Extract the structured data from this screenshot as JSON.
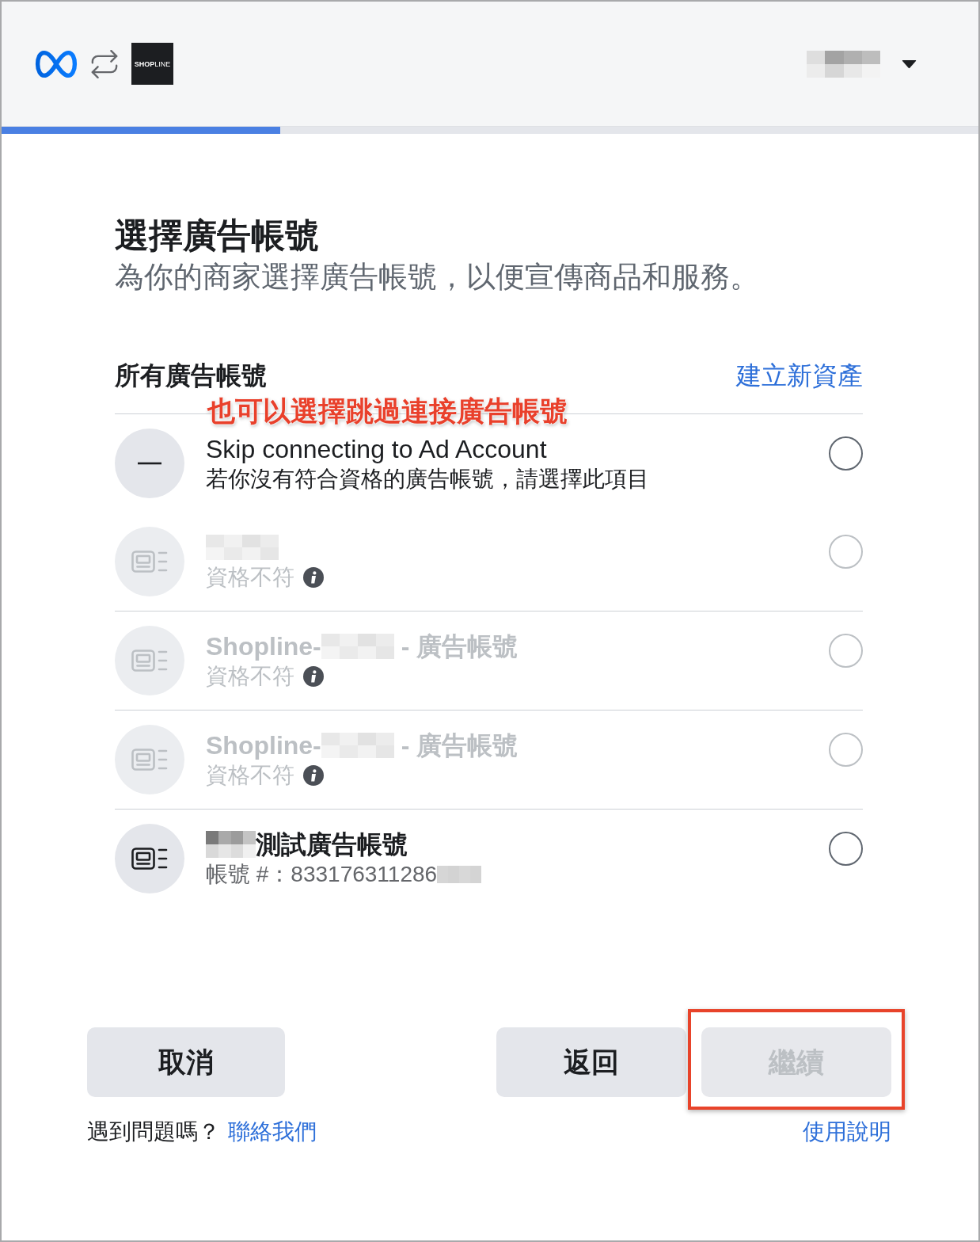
{
  "header": {
    "logo_text": "**SHOP**LINE"
  },
  "progress": {
    "level": 0.285
  },
  "title": "選擇廣告帳號",
  "subtitle": "為你的商家選擇廣告帳號，以便宣傳商品和服務。",
  "list": {
    "heading": "所有廣告帳號",
    "create_link": "建立新資產",
    "annotation": "也可以選擇跳過連接廣告帳號",
    "rows": [
      {
        "kind": "skip",
        "title": [
          {
            "kind": "text",
            "text": "Skip connecting to Ad Account"
          }
        ],
        "subtitle": [
          {
            "kind": "text",
            "text": "若你沒有符合資格的廣告帳號，請選擇此項目"
          }
        ],
        "disabled": false,
        "selected": false
      },
      {
        "kind": "account",
        "title": [
          {
            "kind": "redacted"
          }
        ],
        "subtitle": [
          {
            "kind": "text",
            "text": "資格不符"
          }
        ],
        "disabled": true,
        "selected": false
      },
      {
        "kind": "account",
        "title": [
          {
            "kind": "text",
            "text": "Shopline-"
          },
          {
            "kind": "redacted"
          },
          {
            "kind": "text",
            "text": " - 廣告帳號"
          }
        ],
        "subtitle": [
          {
            "kind": "text",
            "text": "資格不符"
          }
        ],
        "disabled": true,
        "selected": false
      },
      {
        "kind": "account",
        "title": [
          {
            "kind": "text",
            "text": "Shopline-"
          },
          {
            "kind": "redacted"
          },
          {
            "kind": "text",
            "text": " - 廣告帳號"
          }
        ],
        "subtitle": [
          {
            "kind": "text",
            "text": "資格不符"
          }
        ],
        "disabled": true,
        "selected": false
      },
      {
        "kind": "account",
        "title": [
          {
            "kind": "redacted"
          },
          {
            "kind": "text",
            "text": "測試廣告帳號"
          }
        ],
        "subtitle": [
          {
            "kind": "text",
            "text": "帳號 #：833176311286"
          },
          {
            "kind": "redacted"
          }
        ],
        "disabled": false,
        "selected": false
      }
    ]
  },
  "buttons": {
    "left": [
      {
        "label": "取消",
        "disabled": false,
        "highlighted": false
      }
    ],
    "right": [
      {
        "label": "返回",
        "disabled": false,
        "highlighted": false
      },
      {
        "label": "繼續",
        "disabled": true,
        "highlighted": true
      }
    ]
  },
  "help": {
    "question": "遇到問題嗎？",
    "contact_link": "聯絡我們",
    "guide_link": "使用說明"
  }
}
